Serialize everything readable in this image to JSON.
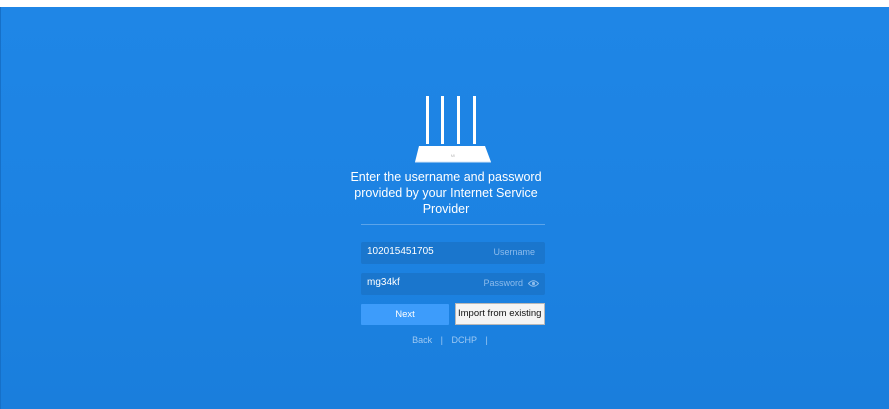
{
  "heading": "Enter the username and password provided by your Internet Service Provider",
  "router_brand": "MI",
  "username": {
    "value": "102015451705",
    "placeholder": "Username"
  },
  "password": {
    "value": "mg34kf",
    "placeholder": "Password"
  },
  "buttons": {
    "next": "Next",
    "import": "Import from existing ro"
  },
  "links": {
    "back": "Back",
    "separator": "|",
    "dchp": "DCHP"
  },
  "icons": {
    "router": "router-icon",
    "eye": "eye-icon"
  },
  "colors": {
    "background": "#1c82e2",
    "next_button": "#3d9cfb",
    "field": "#1a76cd"
  }
}
